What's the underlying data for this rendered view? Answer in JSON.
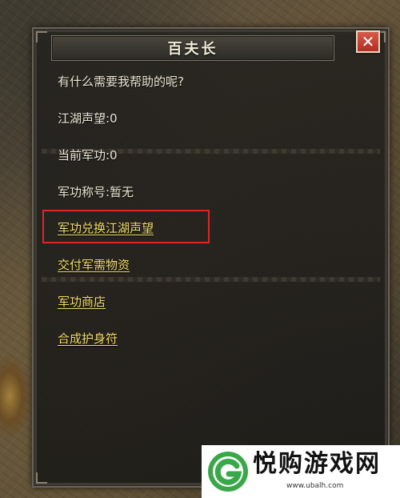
{
  "dialog": {
    "title": "百夫长",
    "close_label": "✕",
    "greeting": "有什么需要我帮助的呢?",
    "stats": [
      {
        "text": "江湖声望:0"
      },
      {
        "text": "当前军功:0"
      },
      {
        "text": "军功称号:暂无"
      }
    ],
    "links": [
      {
        "text": "军功兑换江湖声望"
      },
      {
        "text": "交付军需物资"
      },
      {
        "text": "军功商店"
      },
      {
        "text": "合成护身符"
      }
    ]
  },
  "watermark": {
    "name": "悦购游戏网",
    "url": "www.ubalh.com"
  },
  "colors": {
    "link": "#f2dd6a",
    "text": "#ece6d6",
    "highlight": "#e02424",
    "close_button": "#c0392b",
    "logo_green": "#3aa84a"
  }
}
